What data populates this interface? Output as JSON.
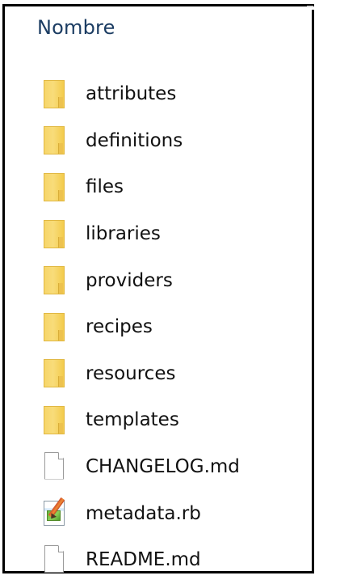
{
  "explorer": {
    "column_header": "Nombre",
    "items": [
      {
        "label": "attributes",
        "icon": "folder-icon"
      },
      {
        "label": "definitions",
        "icon": "folder-icon"
      },
      {
        "label": "files",
        "icon": "folder-icon"
      },
      {
        "label": "libraries",
        "icon": "folder-icon"
      },
      {
        "label": "providers",
        "icon": "folder-icon"
      },
      {
        "label": "recipes",
        "icon": "folder-icon"
      },
      {
        "label": "resources",
        "icon": "folder-icon"
      },
      {
        "label": "templates",
        "icon": "folder-icon"
      },
      {
        "label": "CHANGELOG.md",
        "icon": "file-icon"
      },
      {
        "label": "metadata.rb",
        "icon": "ruby-file-icon"
      },
      {
        "label": "README.md",
        "icon": "file-icon"
      }
    ]
  },
  "colors": {
    "header_text": "#1c3d63",
    "folder": "#f5d162",
    "border": "#000000"
  }
}
